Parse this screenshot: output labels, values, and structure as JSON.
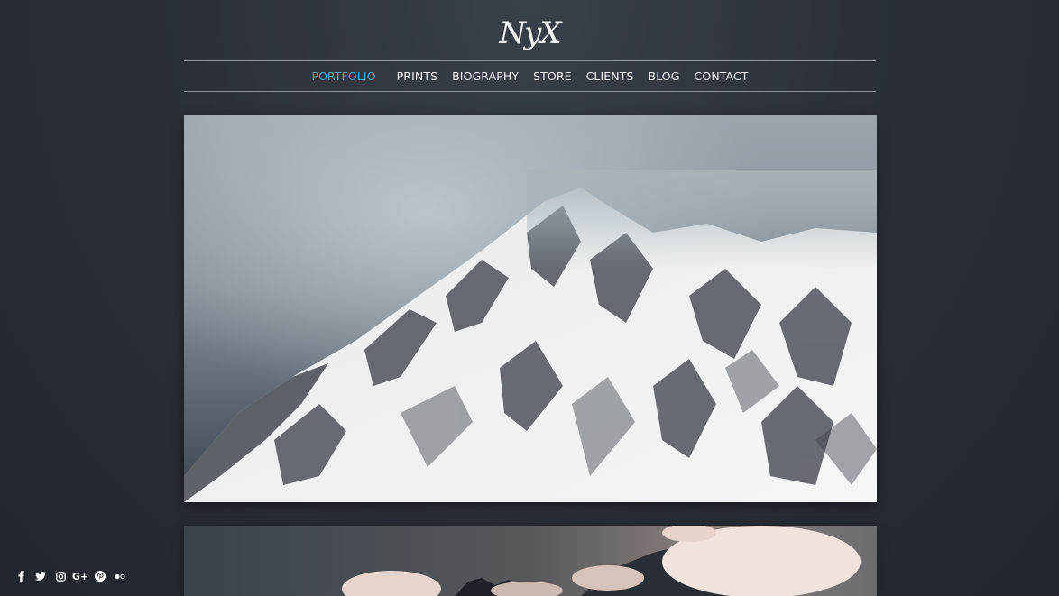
{
  "brand": {
    "logo_text": "NyX"
  },
  "nav": {
    "items": [
      {
        "label": "PORTFOLIO",
        "active": true
      },
      {
        "label": "PRINTS"
      },
      {
        "label": "BIOGRAPHY"
      },
      {
        "label": "STORE"
      },
      {
        "label": "CLIENTS"
      },
      {
        "label": "BLOG"
      },
      {
        "label": "CONTACT"
      }
    ]
  },
  "social": {
    "icons": [
      "facebook-icon",
      "twitter-icon",
      "instagram-icon",
      "google-plus-icon",
      "pinterest-icon",
      "flickr-icon"
    ],
    "google_plus_glyph": "G+"
  },
  "colors": {
    "accent": "#4aa9d6",
    "nav_text": "#f3f3f3",
    "divider": "#8d939c",
    "background": "#2b3038"
  }
}
